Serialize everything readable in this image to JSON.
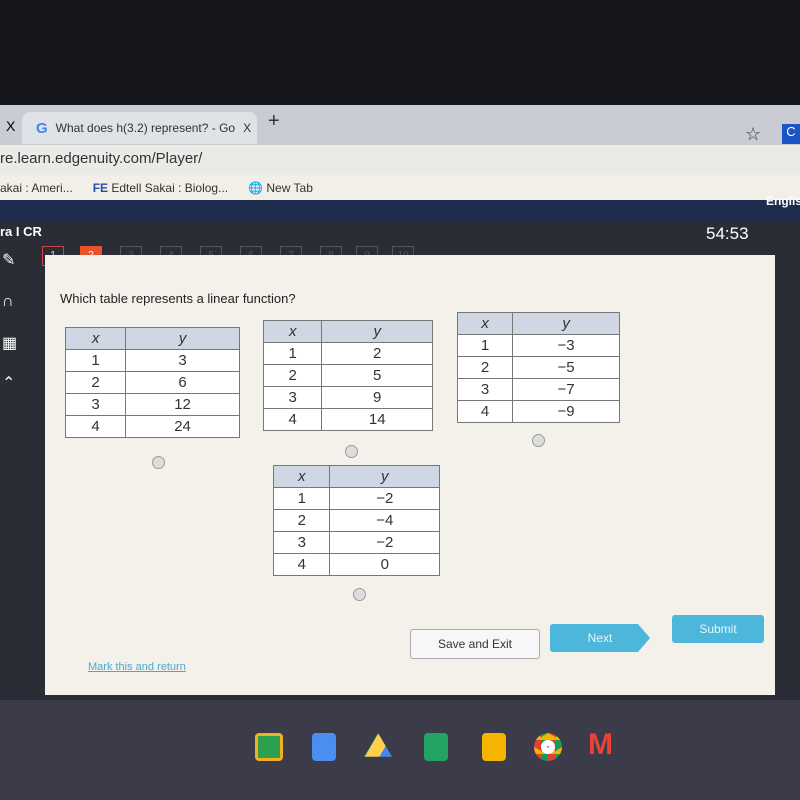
{
  "browser": {
    "tab_title": "What does h(3.2) represent? - Go",
    "close_label": "X",
    "new_tab": "+",
    "url": "re.learn.edgenuity.com/Player/",
    "bookmarks": [
      "akai : Ameri...",
      "Edtell Sakai : Biolog...",
      "New Tab"
    ],
    "profile": "C"
  },
  "header": {
    "language": "Englis",
    "course": "ra I CR",
    "timer": "54:53"
  },
  "question_nav": [
    "1",
    "2",
    "3",
    "4",
    "5",
    "6",
    "7",
    "8",
    "9",
    "10"
  ],
  "question": "Which table represents a linear function?",
  "tables": [
    {
      "headers": [
        "x",
        "y"
      ],
      "rows": [
        [
          "1",
          "3"
        ],
        [
          "2",
          "6"
        ],
        [
          "3",
          "12"
        ],
        [
          "4",
          "24"
        ]
      ]
    },
    {
      "headers": [
        "x",
        "y"
      ],
      "rows": [
        [
          "1",
          "2"
        ],
        [
          "2",
          "5"
        ],
        [
          "3",
          "9"
        ],
        [
          "4",
          "14"
        ]
      ]
    },
    {
      "headers": [
        "x",
        "y"
      ],
      "rows": [
        [
          "1",
          "−3"
        ],
        [
          "2",
          "−5"
        ],
        [
          "3",
          "−7"
        ],
        [
          "4",
          "−9"
        ]
      ]
    },
    {
      "headers": [
        "x",
        "y"
      ],
      "rows": [
        [
          "1",
          "−2"
        ],
        [
          "2",
          "−4"
        ],
        [
          "3",
          "−2"
        ],
        [
          "4",
          "0"
        ]
      ]
    }
  ],
  "buttons": {
    "save": "Save and Exit",
    "next": "Next",
    "submit": "Submit",
    "mark": "Mark this and return"
  },
  "colors": {
    "accent": "#4db7db",
    "current_question": "#e8532b",
    "header": "#1f2c4e"
  }
}
